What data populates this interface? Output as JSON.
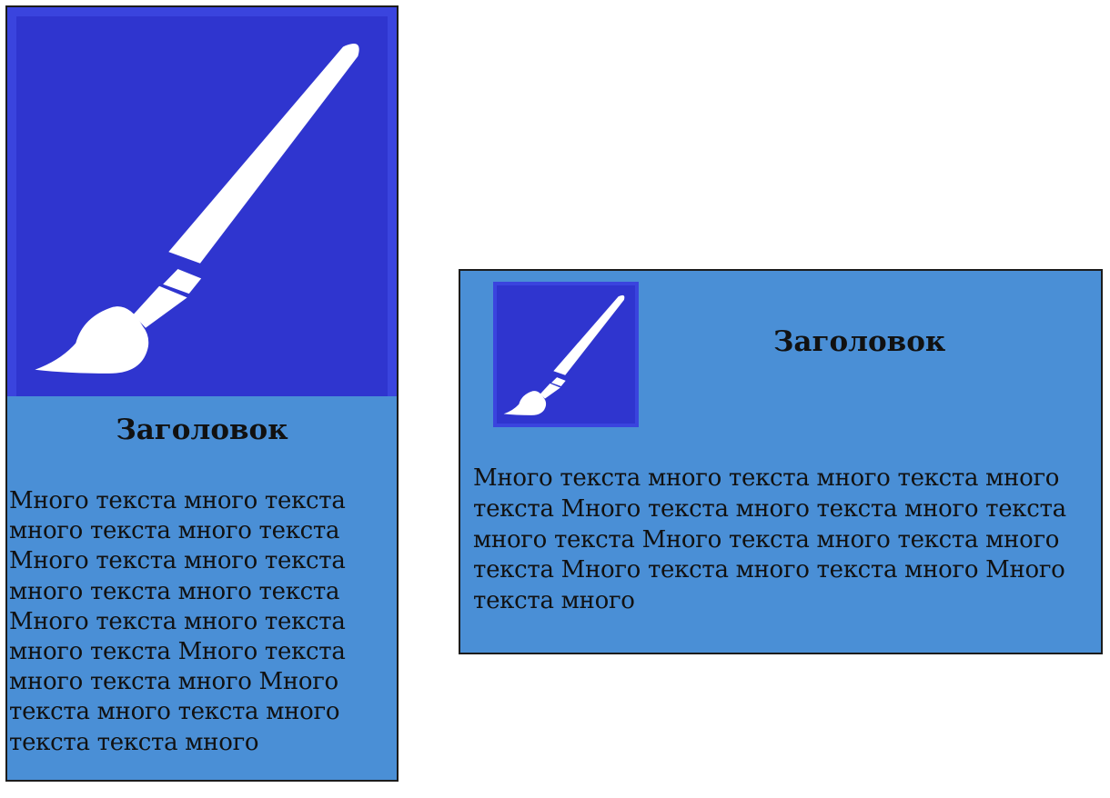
{
  "cards": [
    {
      "layout": "vertical",
      "icon": "paintbrush-icon",
      "title": "Заголовок",
      "body": "Много текста много текста много текста много текста Много текста много текста много текста много текста Много текста много текста много текста Много текста много текста много Много текста много текста много текста текста много"
    },
    {
      "layout": "horizontal",
      "icon": "paintbrush-icon",
      "title": "Заголовок",
      "body": "Много текста много текста много текста много текста Много текста много текста много текста много текста Много текста много текста много текста Много текста много текста много Много текста много"
    }
  ],
  "colors": {
    "card_background": "#4a8fd6",
    "icon_background": "#2f35cf",
    "icon_border": "#3a44de",
    "card_border": "#1c1c1c",
    "brush": "#ffffff"
  }
}
